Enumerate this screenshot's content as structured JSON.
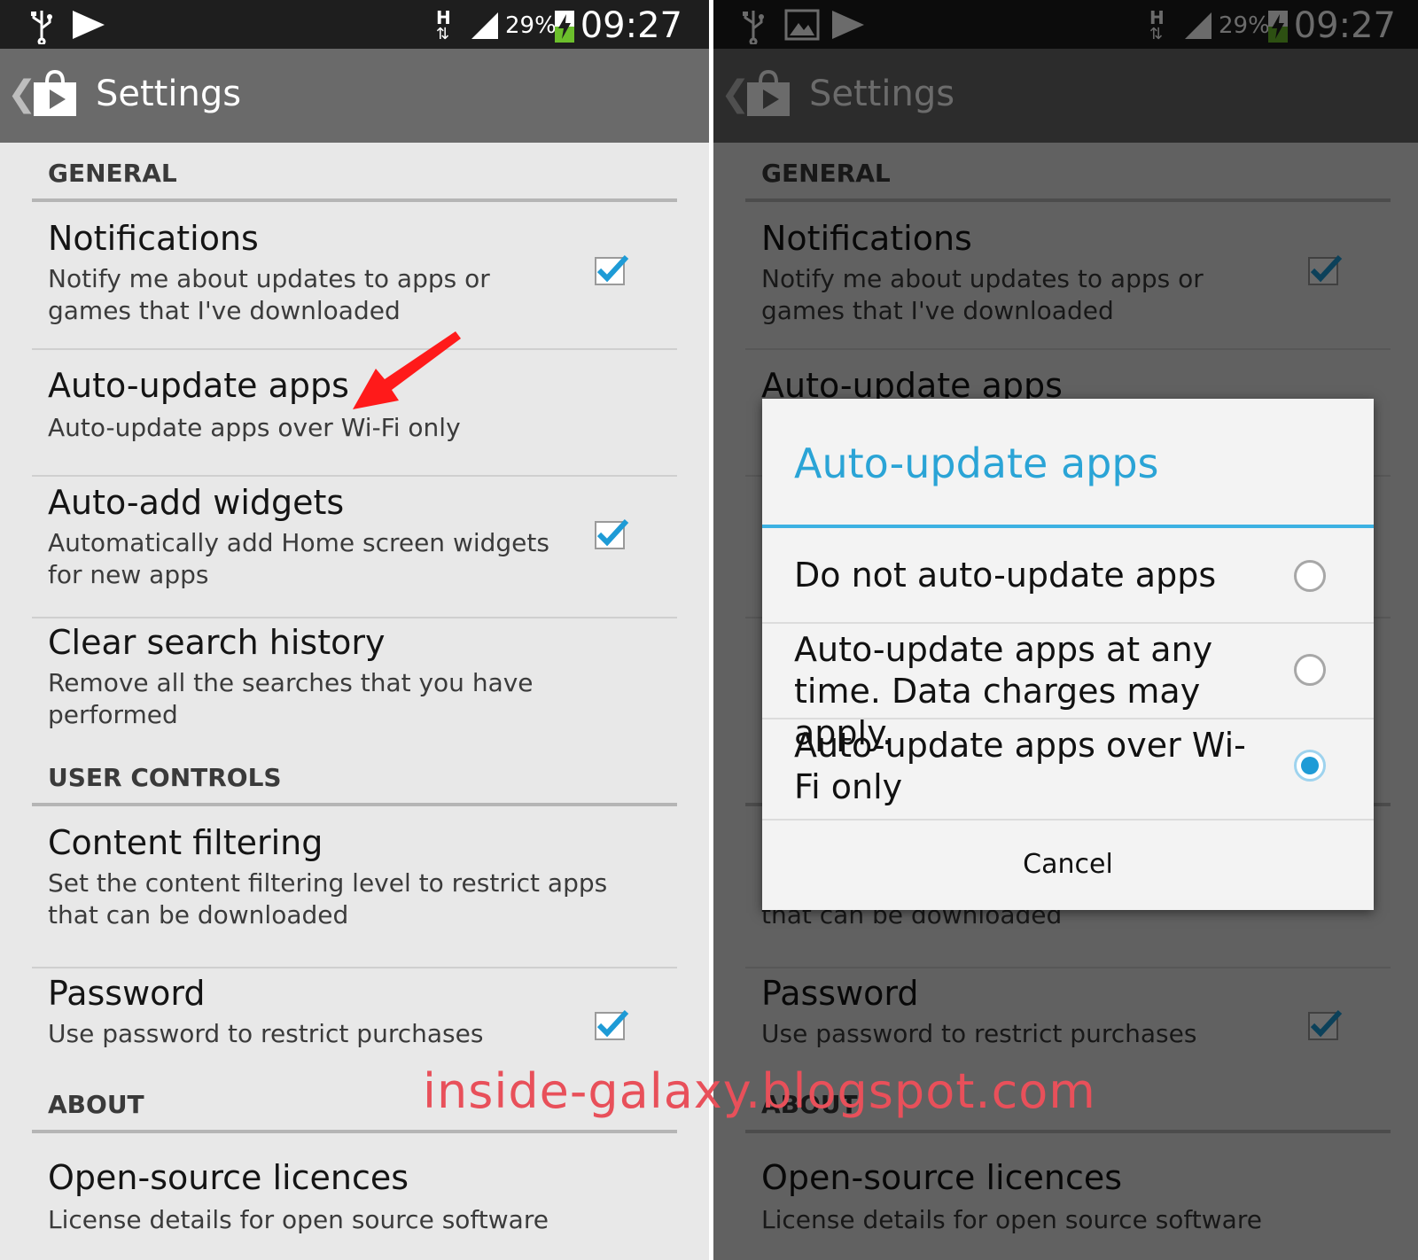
{
  "status_bar": {
    "time": "09:27",
    "battery": "29%",
    "network_type": "H",
    "icons_left": [
      "usb-icon",
      "play-store-notification-icon"
    ],
    "icons_left_right_screen": [
      "usb-icon",
      "image-icon",
      "play-store-notification-icon"
    ]
  },
  "action_bar": {
    "title": "Settings",
    "app_icon": "play-store-bag-icon",
    "back_icon": "chevron-left-icon"
  },
  "settings": {
    "general_header": "GENERAL",
    "user_controls_header": "USER CONTROLS",
    "about_header": "ABOUT",
    "notifications": {
      "title": "Notifications",
      "subtitle": "Notify me about updates to apps or games that I've downloaded",
      "checked": true
    },
    "auto_update": {
      "title": "Auto-update apps",
      "subtitle": "Auto-update apps over Wi-Fi only"
    },
    "auto_add_widgets": {
      "title": "Auto-add widgets",
      "subtitle": "Automatically add Home screen widgets for new apps",
      "checked": true
    },
    "clear_search_history": {
      "title": "Clear search history",
      "subtitle": "Remove all the searches that you have performed"
    },
    "content_filtering": {
      "title": "Content filtering",
      "subtitle": "Set the content filtering level to restrict apps that can be downloaded"
    },
    "password": {
      "title": "Password",
      "subtitle": "Use password to restrict purchases",
      "checked": true
    },
    "open_source": {
      "title": "Open-source licences",
      "subtitle": "License details for open source software"
    }
  },
  "dialog": {
    "title": "Auto-update apps",
    "options": [
      {
        "label": "Do not auto-update apps",
        "selected": false
      },
      {
        "label": "Auto-update apps at any time. Data charges may apply.",
        "selected": false
      },
      {
        "label": "Auto-update apps over Wi-Fi only",
        "selected": true
      }
    ],
    "cancel_label": "Cancel"
  },
  "watermark": "inside-galaxy.blogspot.com",
  "colors": {
    "accent": "#2aa4d6",
    "checkbox": "#1e9bd6",
    "arrow": "#ff1a1a",
    "watermark": "#e8505a"
  }
}
